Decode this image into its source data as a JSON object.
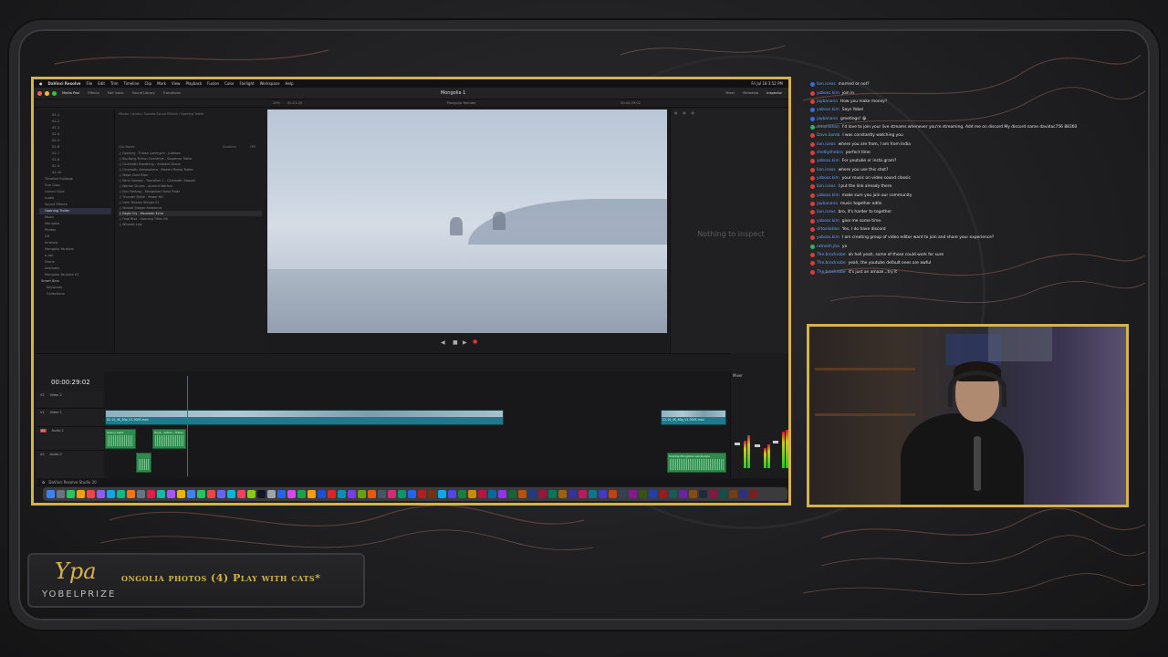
{
  "mac_menu": {
    "app": "DaVinci Resolve",
    "items": [
      "File",
      "Edit",
      "Trim",
      "Timeline",
      "Clip",
      "Mark",
      "View",
      "Playback",
      "Fusion",
      "Color",
      "Fairlight",
      "Workspace",
      "Help"
    ],
    "clock": "Fri Jul 18  3:52 PM"
  },
  "resolve": {
    "project_title": "Mongolia 1",
    "top_buttons": [
      "Media Pool",
      "Effects",
      "Edit Index",
      "Sound Library",
      "Transitions",
      "Mixer",
      "Metadata",
      "Inspector"
    ],
    "viewer_name": "Mongolia Youtube",
    "viewer_tc": "00:00:29:02",
    "zoom": "29%",
    "duration": "00:21:20",
    "inspector_empty": "Nothing to inspect",
    "timeline_tc": "00:00:29:02",
    "mixer_label": "Mixer",
    "statusbar": "DaVinci Resolve Studio 20",
    "left_tree": [
      "02-1",
      "02-2",
      "02-3",
      "02-4",
      "02-5",
      "02-6",
      "02-7",
      "02-8",
      "02-9",
      "02-10",
      "Timeline Footage",
      "Sub Clips",
      "Linked Clips",
      "Audio",
      "Sound Effects",
      "Opening Trailer",
      "Music",
      "Mongolia",
      "Photos",
      "Gif",
      "Animals",
      "Mongolia Youtube",
      "b-roll",
      "Drone",
      "Dramatic",
      "Mongolia Youtube 02"
    ],
    "left_selected_index": 15,
    "smart_bins": [
      "Smart Bins",
      "Keywords",
      "Collections"
    ],
    "clip_list_path": "Master / Audio / Sounds Sound Effects / Opening Trailer",
    "clip_header": [
      "Clip Name",
      "Duration",
      "FPS"
    ],
    "clips": [
      "Opening - Tristan Lohengrin - Jukebox",
      "Big-Bang-Fiction-Overdrive - Suspense Trailer",
      "Cinematic Breathing - Ambient Drone",
      "Cinematic Atmosphere - Modern Rising Trailer",
      "Magic Dust Riser",
      "Wind Swoosh - Transition 1 - Cinematic Swoosh",
      "Warrior Drums - Ancient Warfare",
      "Epic Fantasy - Mongolian Horse Rider",
      "Thunder Strike - Power Hit",
      "Dark Tension Stinger 01",
      "Nomad Steppe Ambience",
      "Eagle Cry - Mountain Echo",
      "Final Rise - Opening Titles Hit",
      "Whoosh Low"
    ],
    "clip_selected_index": 11,
    "tracks": [
      {
        "id": "V2",
        "name": "Video 2"
      },
      {
        "id": "V1",
        "name": "Video 1"
      },
      {
        "id": "A1",
        "name": "Audio 1"
      },
      {
        "id": "A2",
        "name": "Audio 2"
      }
    ],
    "video_clip_main": "02-10_4K_60p_V1-0003.mov",
    "video_clip_end": "02-10_4K_60p_V1-0005.mov",
    "audio_clip_a": "Grainy Light",
    "audio_clip_b": "Hook - Action - Trailer",
    "audio_clip_c": "Soaring Mongolian Landscape"
  },
  "chat": [
    {
      "name": "lion.iceos",
      "text": "married or not?",
      "badge": "#3a6bd8"
    },
    {
      "name": "yoboss.kim",
      "text": "join in",
      "badge": "#e03a3a"
    },
    {
      "name": "jaybanana",
      "text": "How you make money?",
      "badge": "#e03a3a"
    },
    {
      "name": "yoboss.kim",
      "text": "Says Yobel",
      "badge": "#3a6bd8"
    },
    {
      "name": "jaybanana",
      "text": "greetings! 😀",
      "badge": "#3a6bd8"
    },
    {
      "name": "drtoxilation",
      "text": "I'd love to join your live streams whenever you're streaming. Add me on discord My discord name davidac756 88360",
      "badge": "#35b06a"
    },
    {
      "name": "Dave.bomb",
      "text": "I was constantly watching you",
      "badge": "#e03a3a"
    },
    {
      "name": "lion.iceos",
      "text": "where you are from, I am from India",
      "badge": "#e03a3a"
    },
    {
      "name": "shelbythebro",
      "text": "perfect time",
      "badge": "#e03a3a"
    },
    {
      "name": "yoboss.kim",
      "text": "For youtube or insta gram?",
      "badge": "#e03a3a"
    },
    {
      "name": "lion.iceos",
      "text": "where you use this shot?",
      "badge": "#e03a3a"
    },
    {
      "name": "yoboss.kim",
      "text": "your music on video sound classic",
      "badge": "#e03a3a"
    },
    {
      "name": "lion.iceos",
      "text": "I put the link already there",
      "badge": "#e03a3a"
    },
    {
      "name": "yoboss.kim",
      "text": "make sure you join our community",
      "badge": "#e03a3a"
    },
    {
      "name": "jaybanana",
      "text": "music together edits",
      "badge": "#e03a3a"
    },
    {
      "name": "lion.iceos",
      "text": "bro, it's harder to together",
      "badge": "#e03a3a"
    },
    {
      "name": "yoboss.kim",
      "text": "give me some time.",
      "badge": "#e03a3a"
    },
    {
      "name": "drtoxilation",
      "text": "Yes, I do have discord",
      "badge": "#e03a3a"
    },
    {
      "name": "yoboss.kim",
      "text": "I am creating group of video editor want to join and share your experience?",
      "badge": "#e03a3a"
    },
    {
      "name": "ratnesh.jha",
      "text": "yo",
      "badge": "#35b06a"
    },
    {
      "name": "The.brockrobe",
      "text": "ah hell yeah, some of those could work for sure",
      "badge": "#e03a3a"
    },
    {
      "name": "The.brockrobe",
      "text": "yeah, the youtube default ones are awful",
      "badge": "#e03a3a"
    },
    {
      "name": "The.brockrobe",
      "text": "it's just an amaze...try it",
      "badge": "#e03a3a"
    }
  ],
  "brand": {
    "logo": "Ypa",
    "name": "YOBELPRIZE",
    "ticker": "ongolia photos (4) Play with cats*"
  },
  "colors": {
    "frame_gold": "#d6b34a",
    "chat_name": "#5fa3ff",
    "accent_copper": "#8a5a4a"
  }
}
